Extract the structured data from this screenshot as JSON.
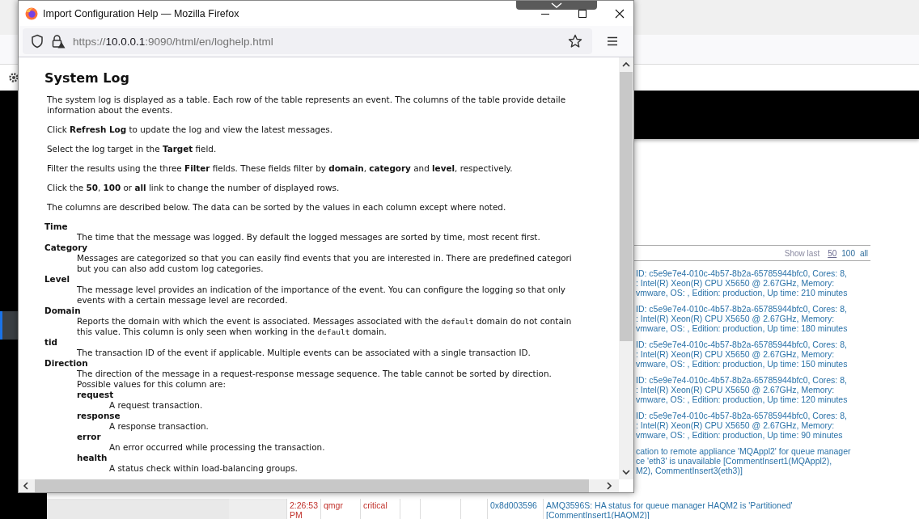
{
  "background": {
    "show_last": {
      "label": "Show last",
      "options": [
        {
          "label": "50",
          "selected": true
        },
        {
          "label": "100",
          "selected": false
        },
        {
          "label": "all",
          "selected": false
        }
      ]
    },
    "messages": [
      [
        "ID: c5e9e7e4-010c-4b57-8b2a-65785944bfc0, Cores: 8,",
        ": Intel(R) Xeon(R) CPU X5650 @ 2.67GHz, Memory:",
        "vmware, OS: , Edition: production, Up time: 210 minutes"
      ],
      [
        "ID: c5e9e7e4-010c-4b57-8b2a-65785944bfc0, Cores: 8,",
        ": Intel(R) Xeon(R) CPU X5650 @ 2.67GHz, Memory:",
        "vmware, OS: , Edition: production, Up time: 180 minutes"
      ],
      [
        "ID: c5e9e7e4-010c-4b57-8b2a-65785944bfc0, Cores: 8,",
        ": Intel(R) Xeon(R) CPU X5650 @ 2.67GHz, Memory:",
        "vmware, OS: , Edition: production, Up time: 150 minutes"
      ],
      [
        "ID: c5e9e7e4-010c-4b57-8b2a-65785944bfc0, Cores: 8,",
        ": Intel(R) Xeon(R) CPU X5650 @ 2.67GHz, Memory:",
        "vmware, OS: , Edition: production, Up time: 120 minutes"
      ],
      [
        "ID: c5e9e7e4-010c-4b57-8b2a-65785944bfc0, Cores: 8,",
        ": Intel(R) Xeon(R) CPU X5650 @ 2.67GHz, Memory:",
        "vmware, OS: , Edition: production, Up time: 90 minutes"
      ],
      [
        "cation to remote appliance 'MQAppl2' for queue manager",
        "ce 'eth3' is unavailable [CommentInsert1(MQAppl2),",
        "M2), CommentInsert3(eth3)]"
      ]
    ],
    "last_row": {
      "time": "2:26:53 PM",
      "category": "qmgr",
      "level": "critical",
      "tid": "0x8d003596",
      "message": "AMQ3596S: HA status for queue manager HAQM2 is 'Partitioned' [CommentInsert1(HAQM2)]"
    }
  },
  "popup": {
    "window": {
      "title": "Import Configuration Help — Mozilla Firefox"
    },
    "url": "https://**10.0.0.1**:9090/html/en/loghelp.html",
    "heading": "System Log",
    "paragraphs": [
      [
        "The system log is displayed as a table. Each row of the table represents an event. The columns of the table provide detaile",
        "information about the events."
      ],
      [
        "Click **Refresh Log** to update the log and view the latest messages."
      ],
      [
        "Select the log target in the **Target** field."
      ],
      [
        "Filter the results using the three **Filter** fields. These fields filter by **domain**, **category** and **level**, respectively."
      ],
      [
        "Click the **50**, **100** or **all** link to change the number of displayed rows."
      ],
      [
        "The columns are described below. The data can be sorted by the values in each column except where noted."
      ]
    ],
    "definitions": [
      {
        "term": "Time",
        "lines": [
          "The time that the message was logged. By default the logged messages are sorted by time, most recent first."
        ]
      },
      {
        "term": "Category",
        "lines": [
          "Messages are categorized so that you can easily find events that you are interested in. There are predefined categori",
          "but you can also add custom log categories."
        ]
      },
      {
        "term": "Level",
        "lines": [
          "The message level provides an indication of the importance of the event. You can configure the logging so that only",
          "events with a certain message level are recorded."
        ]
      },
      {
        "term": "Domain",
        "lines": [
          [
            {
              "text": "Reports the domain with which the event is associated. Messages associated with the ",
              "kind": "text"
            },
            {
              "text": "default",
              "kind": "code"
            },
            {
              "text": " domain do not contain",
              "kind": "text"
            }
          ],
          [
            {
              "text": "this value. This column is only seen when working in the ",
              "kind": "text"
            },
            {
              "text": "default",
              "kind": "code"
            },
            {
              "text": " domain.",
              "kind": "text"
            }
          ]
        ]
      },
      {
        "term": "tid",
        "lines": [
          "The transaction ID of the event if applicable. Multiple events can be associated with a single transaction ID."
        ]
      },
      {
        "term": "Direction",
        "lines": [
          "The direction of the message in a request-response message sequence. The table cannot be sorted by direction.",
          "Possible values for this column are:"
        ],
        "children": [
          {
            "term": "request",
            "lines": [
              "A request transaction."
            ]
          },
          {
            "term": "response",
            "lines": [
              "A response transaction."
            ]
          },
          {
            "term": "error",
            "lines": [
              "An error occurred while processing the transaction."
            ]
          },
          {
            "term": "health",
            "lines": [
              "A status check within load-balancing groups."
            ]
          }
        ]
      }
    ]
  }
}
